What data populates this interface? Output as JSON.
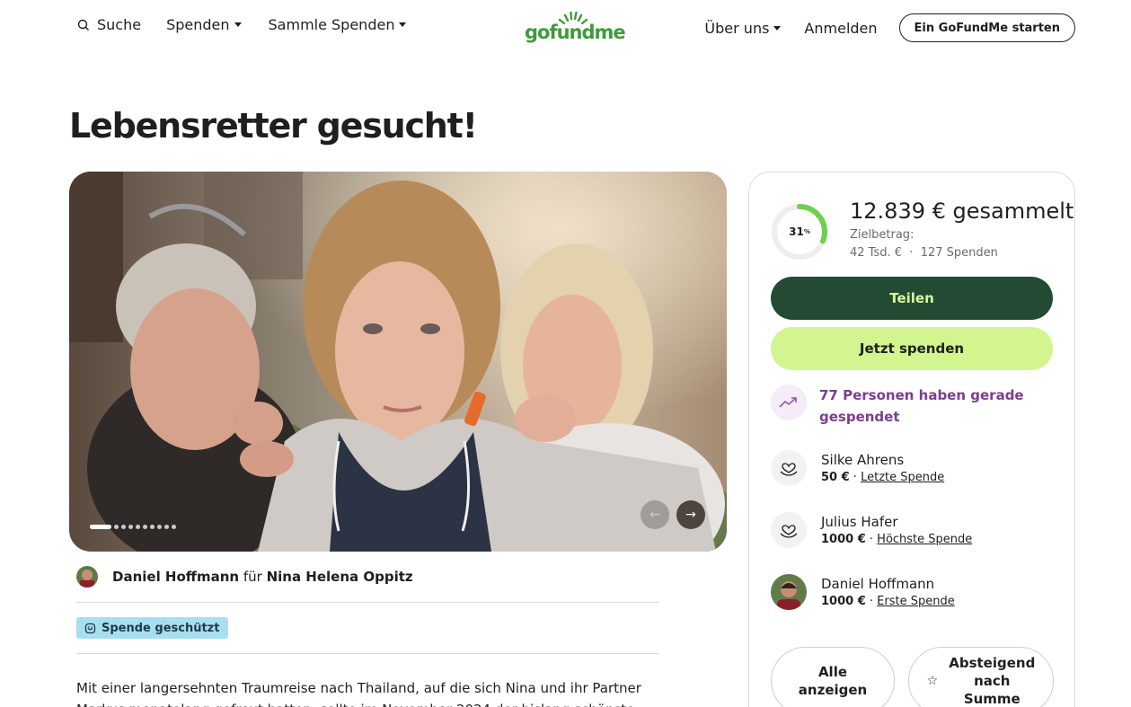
{
  "header": {
    "search_label": "Suche",
    "spenden_label": "Spenden",
    "sammle_label": "Sammle Spenden",
    "logo_text": "gofundme",
    "ueber_label": "Über uns",
    "login_label": "Anmelden",
    "start_label": "Ein GoFundMe starten"
  },
  "campaign": {
    "title": "Lebensretter gesucht!",
    "organizer_name": "Daniel Hoffmann",
    "for_word": "für",
    "beneficiary": "Nina Helena Oppitz",
    "badge": "Spende geschützt",
    "description": "Mit einer langersehnten Traumreise nach Thailand, auf die sich Nina und ihr Partner Markus monatelang gefreut hatten, sollte im November 2024 der bislang schönste",
    "gallery_count": 10,
    "gallery_active": 1
  },
  "sidebar": {
    "progress_percent": 31,
    "progress_label": "31",
    "progress_unit": "%",
    "amount": "12.839 € gesammelt",
    "goal_label": "Zielbetrag:",
    "goal_value": "42 Tsd. €",
    "separator": "·",
    "donation_count": "127 Spenden",
    "share_label": "Teilen",
    "donate_label": "Jetzt spenden",
    "trend_text": "77 Personen haben gerade gespendet",
    "donors": [
      {
        "name": "Silke Ahrens",
        "amount": "50 €",
        "sep": " · ",
        "tag": "Letzte Spende"
      },
      {
        "name": "Julius Hafer",
        "amount": "1000 €",
        "sep": " · ",
        "tag": "Höchste Spende"
      },
      {
        "name": "Daniel Hoffmann",
        "amount": "1000 €",
        "sep": " · ",
        "tag": "Erste Spende"
      }
    ],
    "show_all_line1": "Alle",
    "show_all_line2": "anzeigen",
    "sort_line1": "Absteigend",
    "sort_line2": "nach",
    "sort_line3": "Summe"
  },
  "colors": {
    "brand_green": "#3f9a3b",
    "share_bg": "#234a33",
    "share_text": "#d8f6a0",
    "donate_bg": "#d2f590",
    "trend_purple": "#7b3d91",
    "badge_bg": "#a8dff0",
    "progress_green": "#6fcf4f"
  }
}
